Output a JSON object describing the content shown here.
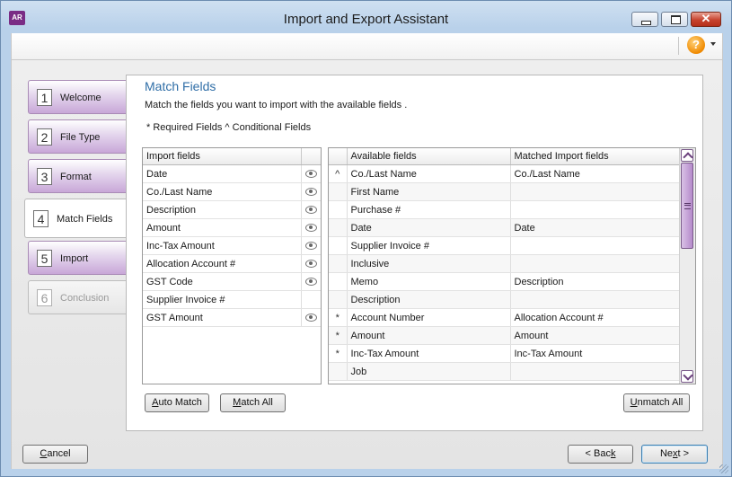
{
  "window": {
    "icon_text": "AR",
    "title": "Import and Export Assistant",
    "minimize_glyph": "",
    "close_glyph": "✕"
  },
  "toolbar": {
    "help_glyph": "?"
  },
  "steps": [
    {
      "num": "1",
      "label": "Welcome",
      "state": "normal"
    },
    {
      "num": "2",
      "label": "File Type",
      "state": "normal"
    },
    {
      "num": "3",
      "label": "Format",
      "state": "normal"
    },
    {
      "num": "4",
      "label": "Match Fields",
      "state": "active"
    },
    {
      "num": "5",
      "label": "Import",
      "state": "normal"
    },
    {
      "num": "6",
      "label": "Conclusion",
      "state": "disabled"
    }
  ],
  "panel": {
    "title": "Match Fields",
    "description": "Match the fields you want to import with the available fields .",
    "legend": "* Required Fields  ^ Conditional Fields"
  },
  "import_fields": {
    "header": "Import fields",
    "rows": [
      {
        "name": "Date",
        "eye": true
      },
      {
        "name": "Co./Last Name",
        "eye": true
      },
      {
        "name": "Description",
        "eye": true
      },
      {
        "name": "Amount",
        "eye": true
      },
      {
        "name": "Inc-Tax Amount",
        "eye": true
      },
      {
        "name": "Allocation Account #",
        "eye": true
      },
      {
        "name": "GST Code",
        "eye": true
      },
      {
        "name": "Supplier Invoice #",
        "eye": false
      },
      {
        "name": "GST Amount",
        "eye": true
      }
    ]
  },
  "available_fields": {
    "header_available": "Available fields",
    "header_matched": "Matched Import fields",
    "rows": [
      {
        "mark": "^",
        "field": "Co./Last Name",
        "matched": "Co./Last Name"
      },
      {
        "mark": "",
        "field": "First Name",
        "matched": ""
      },
      {
        "mark": "",
        "field": "Purchase #",
        "matched": ""
      },
      {
        "mark": "",
        "field": "Date",
        "matched": "Date"
      },
      {
        "mark": "",
        "field": "Supplier Invoice #",
        "matched": ""
      },
      {
        "mark": "",
        "field": "Inclusive",
        "matched": ""
      },
      {
        "mark": "",
        "field": "Memo",
        "matched": "Description"
      },
      {
        "mark": "",
        "field": "Description",
        "matched": ""
      },
      {
        "mark": "*",
        "field": "Account Number",
        "matched": "Allocation Account #"
      },
      {
        "mark": "*",
        "field": "Amount",
        "matched": "Amount"
      },
      {
        "mark": "*",
        "field": "Inc-Tax Amount",
        "matched": "Inc-Tax Amount"
      },
      {
        "mark": "",
        "field": "Job",
        "matched": ""
      }
    ]
  },
  "buttons": {
    "auto_match": {
      "accel": "A",
      "rest": "uto Match"
    },
    "match_all": {
      "accel": "M",
      "rest": "atch All"
    },
    "unmatch_all": {
      "accel": "U",
      "rest": "nmatch All"
    },
    "cancel": {
      "pre": "",
      "accel": "C",
      "rest": "ancel"
    },
    "back": {
      "pre": "< Bac",
      "accel": "k",
      "rest": ""
    },
    "next": {
      "pre": "Ne",
      "accel": "x",
      "rest": "t >"
    }
  }
}
